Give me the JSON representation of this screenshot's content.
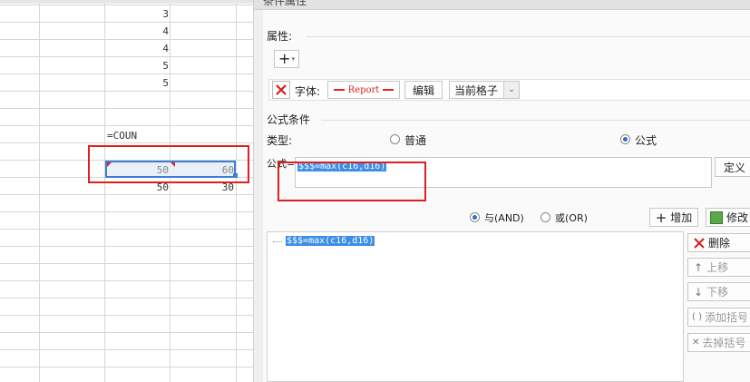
{
  "sheet": {
    "col_b_values": [
      "3",
      "4",
      "4",
      "5",
      "5"
    ],
    "formula_text": "=COUN",
    "selected_row": [
      "50",
      "60"
    ],
    "result_row": [
      "50",
      "30"
    ]
  },
  "dialog": {
    "title": "条件属性",
    "properties": {
      "section_label": "属性:",
      "font_label": "字体:",
      "font_sample": "Report",
      "edit_button": "编辑",
      "scope_select": "当前格子"
    },
    "formula_condition": {
      "section_label": "公式条件",
      "type_label": "类型:",
      "option_normal": "普通",
      "option_formula": "公式",
      "formula_label": "公式=",
      "formula_value": "$$$=max(c16,d16)",
      "define_button": "定义",
      "and_label": "与(AND)",
      "or_label": "或(OR)",
      "add_button": "增加",
      "modify_button": "修改",
      "tree_item": "$$$=max(c16,d16)",
      "delete_button": "删除",
      "move_up_button": "上移",
      "move_down_button": "下移",
      "add_paren_button": "添加括号",
      "remove_paren_button": "去掉括号"
    },
    "colors": {
      "accent": "#3d8ee6",
      "highlight_border": "#e02020"
    }
  }
}
